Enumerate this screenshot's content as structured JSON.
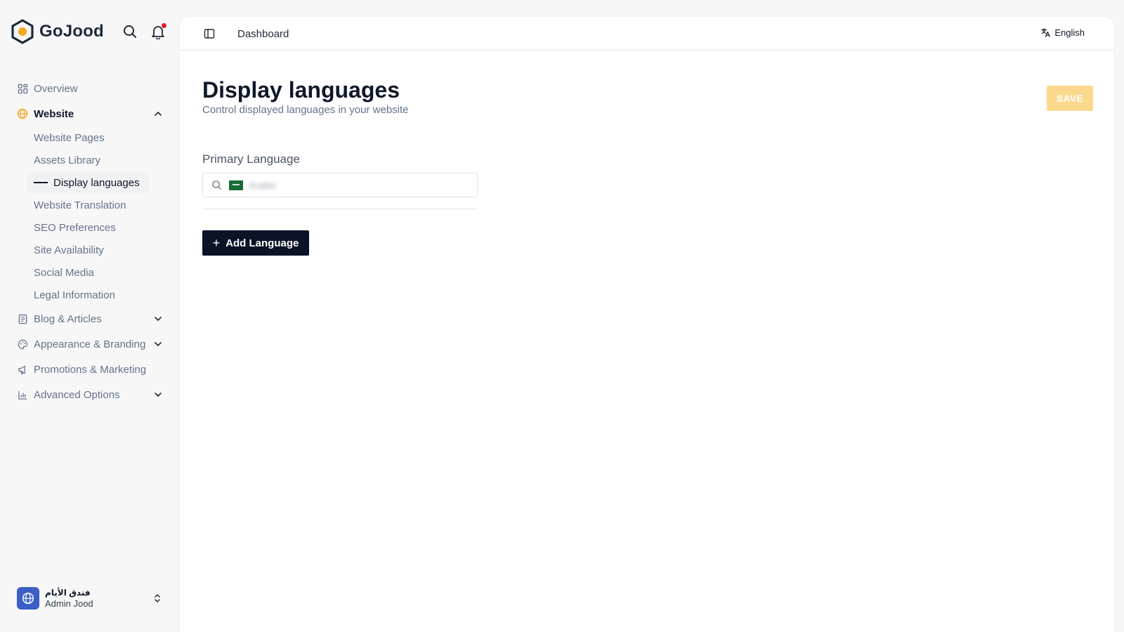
{
  "brand": {
    "name": "GoJood"
  },
  "colors": {
    "accent": "#f5a623",
    "save_disabled": "#fcd88c",
    "primary_button": "#0b1327"
  },
  "top_icons": [
    "search-icon",
    "bell-icon"
  ],
  "sidebar": {
    "items": [
      {
        "label": "Overview",
        "icon": "grid-icon"
      },
      {
        "label": "Website",
        "icon": "globe-icon",
        "expanded": true,
        "children": [
          {
            "label": "Website Pages"
          },
          {
            "label": "Assets Library"
          },
          {
            "label": "Display languages",
            "current": true
          },
          {
            "label": "Website Translation"
          },
          {
            "label": "SEO Preferences"
          },
          {
            "label": "Site Availability"
          },
          {
            "label": "Social Media"
          },
          {
            "label": "Legal Information"
          }
        ]
      },
      {
        "label": "Blog & Articles",
        "icon": "document-icon"
      },
      {
        "label": "Appearance & Branding",
        "icon": "palette-icon"
      },
      {
        "label": "Promotions & Marketing",
        "icon": "megaphone-icon"
      },
      {
        "label": "Advanced Options",
        "icon": "bar-chart-icon"
      }
    ]
  },
  "user": {
    "org": "فندق الأيام",
    "role": "Admin Jood"
  },
  "topbar": {
    "breadcrumb": "Dashboard",
    "language": "English"
  },
  "page": {
    "title": "Display languages",
    "subtitle": "Control displayed languages in your website",
    "save_label": "SAVE",
    "primary_language_label": "Primary Language",
    "primary_language_value": "Arabic",
    "add_language_label": "Add Language"
  }
}
